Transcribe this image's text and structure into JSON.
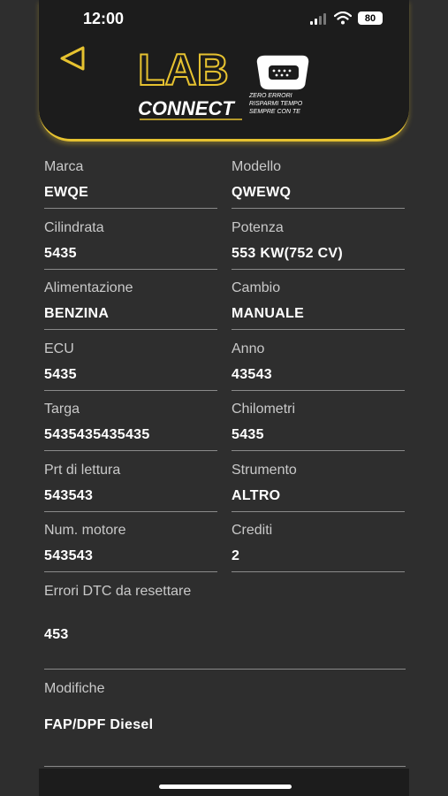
{
  "status_bar": {
    "time": "12:00",
    "battery": "80"
  },
  "brand": {
    "logo_top": "LAB",
    "logo_bottom": "CONNECT",
    "tagline_1": "ZERO ERRORI",
    "tagline_2": "RISPARMI TEMPO",
    "tagline_3": "SEMPRE CON TE",
    "accent": "#e6c230"
  },
  "fields": [
    {
      "label": "Marca",
      "value": "EWQE"
    },
    {
      "label": "Modello",
      "value": "QWEWQ"
    },
    {
      "label": "Cilindrata",
      "value": "5435"
    },
    {
      "label": "Potenza",
      "value": "553 KW(752 CV)"
    },
    {
      "label": "Alimentazione",
      "value": "BENZINA"
    },
    {
      "label": "Cambio",
      "value": "MANUALE"
    },
    {
      "label": "ECU",
      "value": "5435"
    },
    {
      "label": "Anno",
      "value": "43543"
    },
    {
      "label": "Targa",
      "value": "5435435435435"
    },
    {
      "label": "Chilometri",
      "value": "5435"
    },
    {
      "label": "Prt di lettura",
      "value": "543543"
    },
    {
      "label": "Strumento",
      "value": "ALTRO"
    },
    {
      "label": "Num. motore",
      "value": "543543"
    },
    {
      "label": "Crediti",
      "value": "2"
    }
  ],
  "errori_dtc": {
    "label": "Errori DTC da resettare",
    "value": "453"
  },
  "modifiche": {
    "label": "Modifiche",
    "value": "FAP/DPF Diesel"
  }
}
